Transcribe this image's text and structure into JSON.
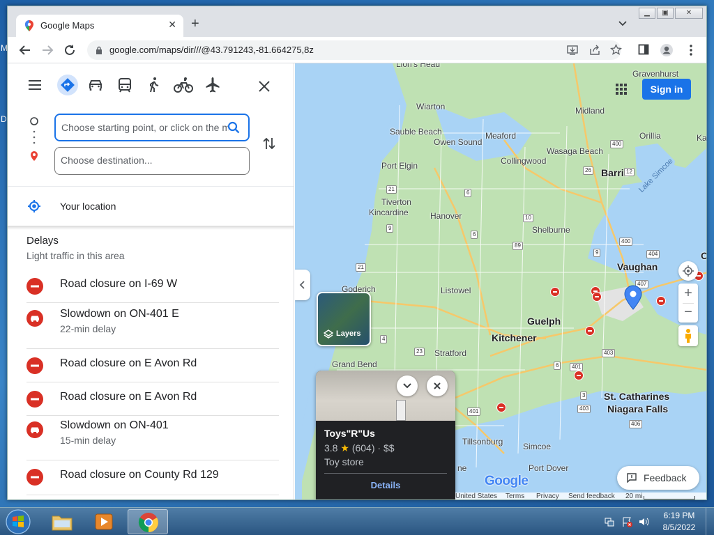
{
  "browser": {
    "tab_title": "Google Maps",
    "url": "google.com/maps/dir///@43.791243,-81.664275,8z"
  },
  "panel": {
    "start_placeholder": "Choose starting point, or click on the map...",
    "destination_placeholder": "Choose destination...",
    "your_location": "Your location",
    "delays_title": "Delays",
    "delays_subtitle": "Light traffic in this area",
    "delays": [
      {
        "type": "closure",
        "title": "Road closure on I-69 W",
        "sub": ""
      },
      {
        "type": "slowdown",
        "title": "Slowdown on ON-401 E",
        "sub": "22-min delay"
      },
      {
        "type": "closure",
        "title": "Road closure on E Avon Rd",
        "sub": ""
      },
      {
        "type": "closure",
        "title": "Road closure on E Avon Rd",
        "sub": ""
      },
      {
        "type": "slowdown",
        "title": "Slowdown on ON-401",
        "sub": "15-min delay"
      },
      {
        "type": "closure",
        "title": "Road closure on County Rd 129",
        "sub": ""
      }
    ]
  },
  "map": {
    "sign_in": "Sign in",
    "layers": "Layers",
    "feedback": "Feedback",
    "google_logo": "Google",
    "footer": {
      "united_states": "United States",
      "terms": "Terms",
      "privacy": "Privacy",
      "send_feedback": "Send feedback",
      "scale": "20 mi"
    },
    "labels": {
      "tc": "Lion's Head",
      "wiarton": "Wiarton",
      "sauble": "Sauble Beach",
      "owen": "Owen Sound",
      "meaford": "Meaford",
      "wasaga": "Wasaga Beach",
      "collingwood": "Collingwood",
      "port_elgin": "Port Elgin",
      "tiverton": "Tiverton",
      "kincardine": "Kincardine",
      "hanover": "Hanover",
      "shelburne": "Shelburne",
      "goderich": "Goderich",
      "listowel": "Listowel",
      "stratford": "Stratford",
      "grand_bend": "Grand Bend",
      "tillsonburg": "Tillsonburg",
      "simcoe": "Simcoe",
      "port_dover": "Port Dover",
      "midland": "Midland",
      "orillia": "Orillia",
      "gravenhurst": "Gravenhurst",
      "kawartha": "Kawa",
      "lake_simcoe": "Lake Simcoe",
      "os": "Os",
      "barrie": "Barrie",
      "vaughan": "Vaughan",
      "guelph": "Guelph",
      "kitchener": "Kitchener",
      "st_catharines": "St. Catharines",
      "niagara": "Niagara Falls",
      "frag_ne": "ne"
    },
    "shields": {
      "s400a": "400",
      "s26": "26",
      "s12": "12",
      "s6a": "6",
      "s21a": "21",
      "s9": "9",
      "s10": "10",
      "s6b": "6",
      "s89": "89",
      "s400b": "400",
      "s404": "404",
      "s9b": "9",
      "s21b": "21",
      "s407": "407",
      "s403": "403",
      "s4": "4",
      "s23": "23",
      "s401a": "401",
      "s401b": "401",
      "s406": "406",
      "s403b": "403",
      "s6c": "6",
      "s3": "3"
    }
  },
  "place_card": {
    "name": "Toys\"R\"Us",
    "rating": "3.8",
    "star": "★",
    "reviews": "(604)",
    "price": "· $$",
    "category": "Toy store",
    "details": "Details"
  },
  "desktop": {
    "frag_m": "M",
    "frag_d": "D"
  },
  "taskbar": {
    "time": "6:19 PM",
    "date": "8/5/2022"
  }
}
